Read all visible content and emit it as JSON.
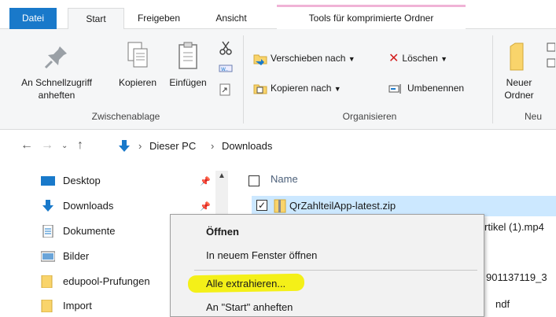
{
  "colors": {
    "accent": "#1979ca",
    "ribbon_bg": "#f5f6f7",
    "tools_tab_border": "#f0b3d6",
    "highlight": "#f4f000",
    "folder": "#f9d46b"
  },
  "tabs": {
    "datei": "Datei",
    "start": "Start",
    "freigeben": "Freigeben",
    "ansicht": "Ansicht",
    "tools": "Tools für komprimierte Ordner"
  },
  "ribbon": {
    "pin_label_1": "An Schnellzugriff",
    "pin_label_2": "anheften",
    "copy_label": "Kopieren",
    "paste_label": "Einfügen",
    "group_clipboard": "Zwischenablage",
    "move_label": "Verschieben nach",
    "copyto_label": "Kopieren nach",
    "delete_label": "Löschen",
    "rename_label": "Umbenennen",
    "group_organize": "Organisieren",
    "newfolder_label_1": "Neuer",
    "newfolder_label_2": "Ordner",
    "group_new": "Neu"
  },
  "address": {
    "crumb_1": "Dieser PC",
    "crumb_2": "Downloads"
  },
  "nav": {
    "items": [
      {
        "label": "Desktop",
        "icon": "desktop-icon"
      },
      {
        "label": "Downloads",
        "icon": "downloads-icon"
      },
      {
        "label": "Dokumente",
        "icon": "documents-icon"
      },
      {
        "label": "Bilder",
        "icon": "pictures-icon"
      },
      {
        "label": "edupool-Prufungen",
        "icon": "folder-icon"
      },
      {
        "label": "Import",
        "icon": "folder-icon"
      }
    ]
  },
  "files": {
    "column_name": "Name",
    "row_1": "QrZahlteilApp-latest.zip",
    "row_2_partial": "rtikel (1).mp4",
    "row_3_partial": "901137119_3",
    "row_4_partial": "ndf"
  },
  "context_menu": {
    "open": "Öffnen",
    "open_new_window": "In neuem Fenster öffnen",
    "extract_all": "Alle extrahieren...",
    "pin_start": "An \"Start\" anheften"
  }
}
